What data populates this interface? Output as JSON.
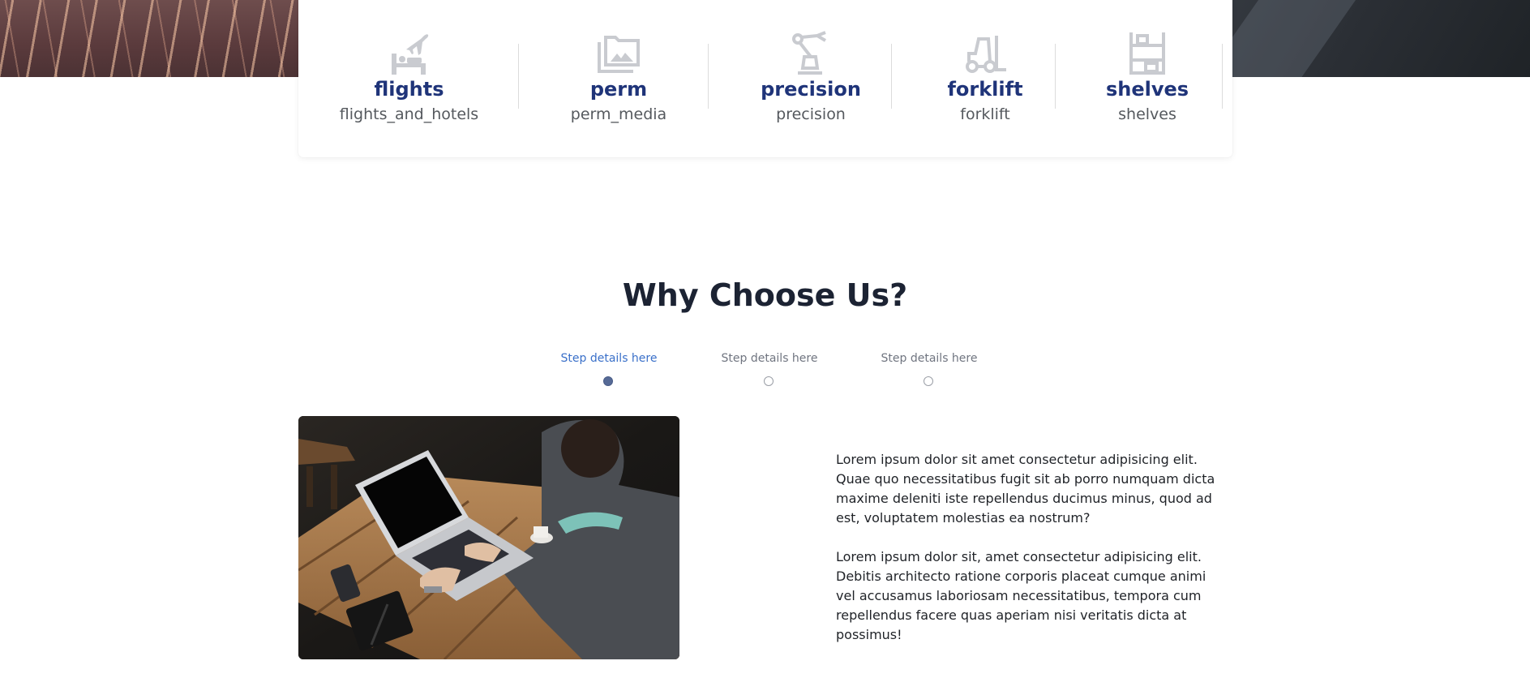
{
  "services": [
    {
      "title": "flights",
      "subtitle": "flights_and_hotels",
      "icon": "flights-and-hotels-icon"
    },
    {
      "title": "perm",
      "subtitle": "perm_media",
      "icon": "perm-media-icon"
    },
    {
      "title": "precision",
      "subtitle": "precision",
      "icon": "precision-robot-arm-icon"
    },
    {
      "title": "forklift",
      "subtitle": "forklift",
      "icon": "forklift-icon"
    },
    {
      "title": "shelves",
      "subtitle": "shelves",
      "icon": "shelves-icon"
    }
  ],
  "section": {
    "title": "Why Choose Us?"
  },
  "steps": [
    {
      "label": "Step details here",
      "active": true
    },
    {
      "label": "Step details here",
      "active": false
    },
    {
      "label": "Step details here",
      "active": false
    }
  ],
  "content": {
    "paragraphs": [
      "Lorem ipsum dolor sit amet consectetur adipisicing elit. Quae quo necessitatibus fugit sit ab porro numquam dicta maxime deleniti iste repellendus ducimus minus, quod ad est, voluptatem molestias ea nostrum?",
      "Lorem ipsum dolor sit, amet consectetur adipisicing elit. Debitis architecto ratione corporis placeat cumque animi vel accusamus laboriosam necessitatibus, tempora cum repellendus facere quas aperiam nisi veritatis dicta at possimus!"
    ]
  },
  "colors": {
    "service_title": "#1f3479",
    "icon_gray": "#c9cbd0",
    "active_step": "#3a70c9",
    "active_dot": "#566a96"
  }
}
